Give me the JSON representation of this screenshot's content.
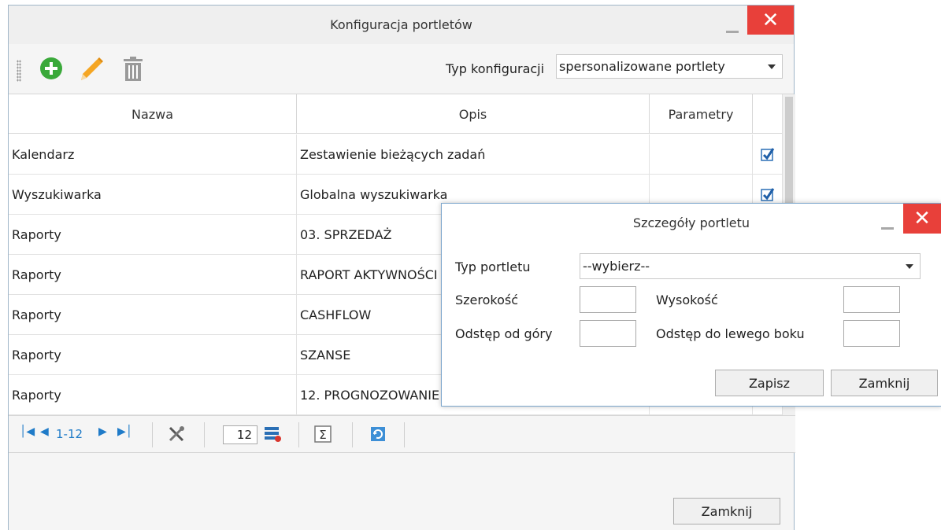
{
  "window": {
    "title": "Konfiguracja portletów",
    "close_glyph": "✕"
  },
  "toolbar": {
    "icons": [
      "add-icon",
      "edit-pencil-icon",
      "trash-icon"
    ],
    "config_label": "Typ konfiguracji",
    "config_value": "spersonalizowane portlety"
  },
  "grid": {
    "headers": [
      "Nazwa",
      "Opis",
      "Parametry",
      ""
    ],
    "rows": [
      {
        "name": "Kalendarz",
        "desc": "Zestawienie bieżących zadań",
        "params": "",
        "checked": true
      },
      {
        "name": "Wyszukiwarka",
        "desc": "Globalna wyszukiwarka",
        "params": "",
        "checked": true
      },
      {
        "name": "Raporty",
        "desc": "03. SPRZEDAŻ",
        "params": "",
        "checked": false
      },
      {
        "name": "Raporty",
        "desc": "RAPORT AKTYWNOŚCI",
        "params": "",
        "checked": false
      },
      {
        "name": "Raporty",
        "desc": "CASHFLOW",
        "params": "",
        "checked": false
      },
      {
        "name": "Raporty",
        "desc": "SZANSE",
        "params": "",
        "checked": false
      },
      {
        "name": "Raporty",
        "desc": "12. PROGNOZOWANIE",
        "params": "",
        "checked": false
      }
    ]
  },
  "pager": {
    "range": "1-12",
    "page_size": "12",
    "icons": [
      "first-page-icon",
      "prev-page-icon",
      "next-page-icon",
      "last-page-icon",
      "tools-icon",
      "columns-icon",
      "sum-icon",
      "refresh-icon"
    ]
  },
  "footer": {
    "close_label": "Zamknij"
  },
  "dialog": {
    "title": "Szczegóły portletu",
    "close_glyph": "✕",
    "type_label": "Typ portletu",
    "type_value": "--wybierz--",
    "width_label": "Szerokość",
    "height_label": "Wysokość",
    "top_label": "Odstęp od góry",
    "left_label": "Odstęp do lewego boku",
    "width_value": "",
    "height_value": "",
    "top_value": "",
    "left_value": "",
    "save_label": "Zapisz",
    "close_label": "Zamknij"
  },
  "colors": {
    "accent": "#1f7bc8",
    "close": "#e8403a",
    "add": "#3aa93a",
    "edit": "#f5a623",
    "trash": "#9a9a9a"
  }
}
